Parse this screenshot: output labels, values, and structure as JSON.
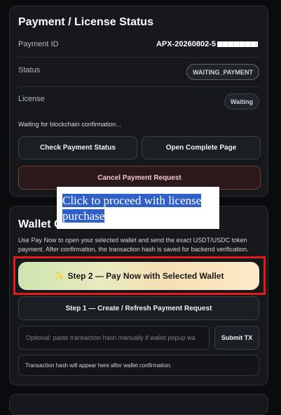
{
  "status_card": {
    "title": "Payment / License Status",
    "payment_id_label": "Payment ID",
    "payment_id_value": "APX-20260802-5",
    "status_label": "Status",
    "status_value": "WAITING_PAYMENT",
    "license_label": "License",
    "license_value": "Waiting",
    "note": "Waiting for blockchain confirmation...",
    "check_button": "Check Payment Status",
    "open_button": "Open Complete Page",
    "cancel_button": "Cancel Payment Request"
  },
  "wallet_card": {
    "title": "Wallet C",
    "description": "Use Pay Now to open your selected wallet and send the exact USDT/USDC token payment. After confirmation, the transaction hash is saved for backend verification.",
    "pay_button": "Step 2 — Pay Now with Selected Wallet",
    "pay_icon": "sparkle-icon",
    "step1_button": "Step 1 — Create / Refresh Payment Request",
    "tx_placeholder": "Optional: paste transaction hash manually if wallet popup wa",
    "submit_button": "Submit TX",
    "hash_note": "Transaction hash will appear here after wallet confirmation."
  },
  "tooltip": {
    "text": "Click to proceed with license purchase"
  },
  "colors": {
    "highlight_box": "#e01b1b",
    "tooltip_highlight": "#2f5fc9",
    "pay_gradient_start": "#cfe5b0",
    "pay_gradient_end": "#fce9c8"
  }
}
